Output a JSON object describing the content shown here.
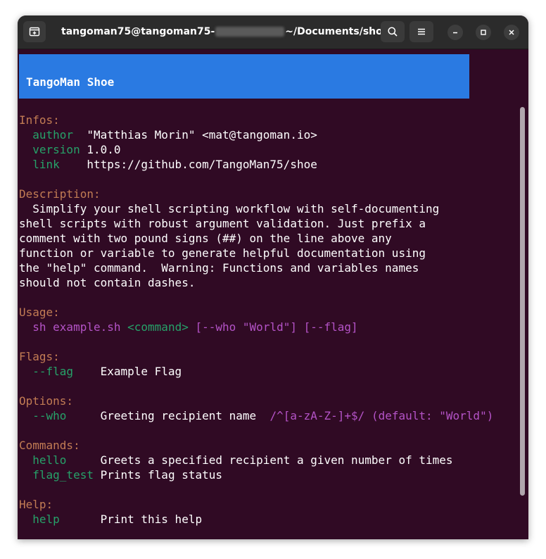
{
  "window": {
    "title_prefix": "tangoman75@tangoman75-",
    "title_suffix": "~/Documents/sho…"
  },
  "banner": {
    "title": "TangoMan Shoe"
  },
  "infos": {
    "header": "Infos:",
    "rows": [
      {
        "key": "author",
        "value": "\"Matthias Morin\" <mat@tangoman.io>"
      },
      {
        "key": "version",
        "value": "1.0.0"
      },
      {
        "key": "link",
        "value": "https://github.com/TangoMan75/shoe"
      }
    ]
  },
  "description": {
    "header": "Description:",
    "lines": [
      "  Simplify your shell scripting workflow with self-documenting",
      "shell scripts with robust argument validation. Just prefix a",
      "comment with two pound signs (##) on the line above any",
      "function or variable to generate helpful documentation using",
      "the \"help\" command.  Warning: Functions and variables names",
      "should not contain dashes."
    ]
  },
  "usage": {
    "header": "Usage:",
    "cmd": "sh example.sh",
    "command_arg": "<command>",
    "who_arg": "[--who \"World\"]",
    "flag_arg": "[--flag]"
  },
  "flags": {
    "header": "Flags:",
    "rows": [
      {
        "name": "--flag",
        "desc": "Example Flag"
      }
    ]
  },
  "options": {
    "header": "Options:",
    "rows": [
      {
        "name": "--who",
        "desc": "Greeting recipient name",
        "pattern": "/^[a-zA-Z-]+$/",
        "default": "(default: \"World\")"
      }
    ]
  },
  "commands": {
    "header": "Commands:",
    "rows": [
      {
        "name": "hello",
        "desc": "Greets a specified recipient a given number of times"
      },
      {
        "name": "flag_test",
        "desc": "Prints flag status"
      }
    ]
  },
  "help": {
    "header": "Help:",
    "rows": [
      {
        "name": "help",
        "desc": "Print this help"
      }
    ]
  },
  "colors": {
    "background": "#300a24",
    "banner": "#2a7ae2",
    "header": "#c27c54",
    "green": "#26a269",
    "magenta": "#b453c7"
  }
}
